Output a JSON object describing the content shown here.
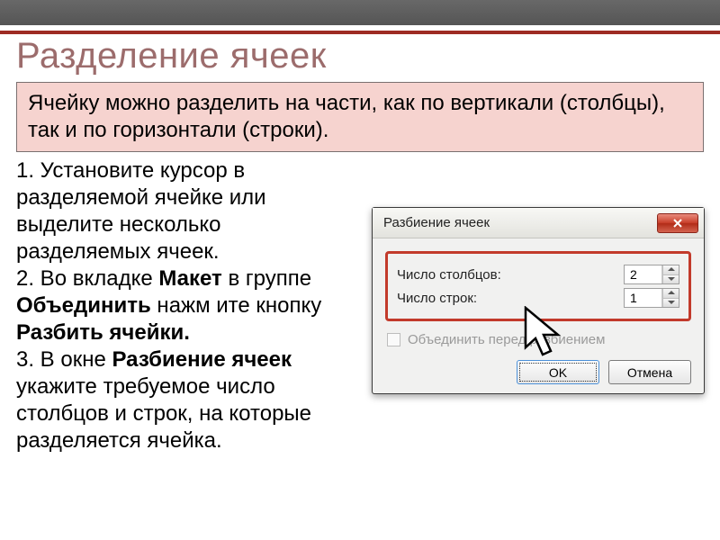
{
  "slide": {
    "title": "Разделение ячеек",
    "intro": "Ячейку можно разделить на части, как по вертикали (столбцы), так и по горизонтали (строки).",
    "step1": "1. Установите курсор в разделяемой ячейке или выделите несколько разделяемых ячеек.",
    "step2_a": "2. Во вкладке ",
    "step2_b": "Макет",
    "step2_c": " в группе ",
    "step2_d": "Объединить",
    "step2_e": " нажм ите кнопку ",
    "step2_f": "Разбить ячейки.",
    "step3_a": "3. В окне ",
    "step3_b": "Разбиение ячеек",
    "step3_c": "  укажите требуемое число столбцов и строк, на которые разделяется ячейка."
  },
  "dialog": {
    "title": "Разбиение ячеек",
    "cols_label": "Число столбцов:",
    "cols_value": "2",
    "rows_label": "Число строк:",
    "rows_value": "1",
    "merge_label": "Объединить перед разбиением",
    "ok": "OK",
    "cancel": "Отмена"
  }
}
